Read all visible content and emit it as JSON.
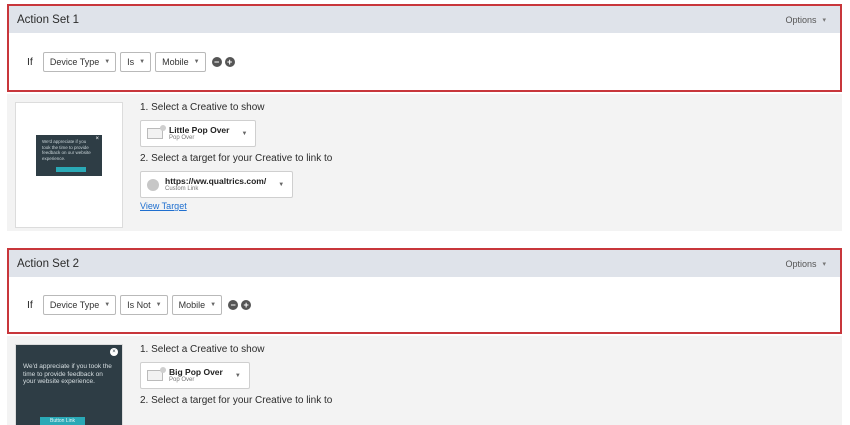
{
  "sets": [
    {
      "title": "Action Set 1",
      "options_label": "Options",
      "if_label": "If",
      "field": "Device Type",
      "operator": "Is",
      "value": "Mobile",
      "preview": {
        "text": "We'd appreciate if you took the time to provide feedback on our website experience.",
        "button": ""
      },
      "step1_label": "1. Select a Creative to show",
      "creative_name": "Little Pop Over",
      "creative_type": "Pop Over",
      "step2_label": "2. Select a target for your Creative to link to",
      "target_name": "https://ww.qualtrics.com/",
      "target_type": "Custom Link",
      "view_target": "View Target"
    },
    {
      "title": "Action Set 2",
      "options_label": "Options",
      "if_label": "If",
      "field": "Device Type",
      "operator": "Is Not",
      "value": "Mobile",
      "preview": {
        "text": "We'd appreciate if you took the time to provide feedback on your website experience.",
        "button": "Button Link"
      },
      "step1_label": "1. Select a Creative to show",
      "creative_name": "Big Pop Over",
      "creative_type": "Pop Over",
      "step2_label": "2. Select a target for your Creative to link to"
    }
  ],
  "icons": {
    "caret": "▾",
    "chevron": "▼",
    "remove": "−",
    "add": "+",
    "close": "×"
  }
}
